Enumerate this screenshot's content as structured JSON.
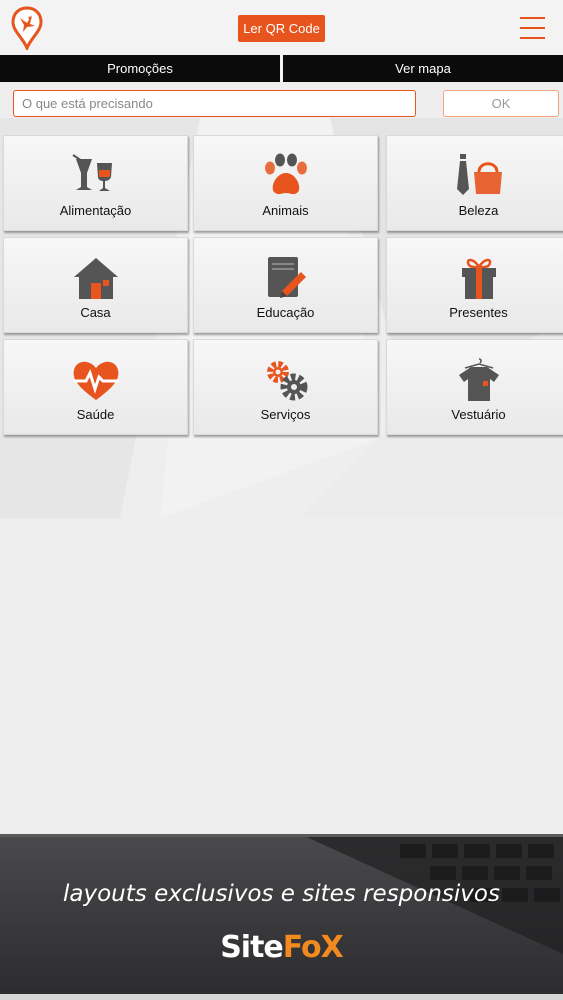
{
  "header": {
    "logo_icon": "location-pin-bird-icon",
    "qr_button_label": "Ler QR Code",
    "menu_icon": "hamburger-menu-icon",
    "accent_color": "#e8541e"
  },
  "tabs": [
    {
      "label": "Promoções"
    },
    {
      "label": "Ver mapa"
    }
  ],
  "search": {
    "placeholder": "O que está precisando",
    "value": "",
    "ok_label": "OK"
  },
  "categories": [
    {
      "label": "Alimentação",
      "icon": "drinks-glasses-icon"
    },
    {
      "label": "Animais",
      "icon": "paw-icon"
    },
    {
      "label": "Beleza",
      "icon": "tie-handbag-icon"
    },
    {
      "label": "Casa",
      "icon": "house-icon"
    },
    {
      "label": "Educação",
      "icon": "notebook-pencil-icon"
    },
    {
      "label": "Presentes",
      "icon": "gift-icon"
    },
    {
      "label": "Saúde",
      "icon": "heart-pulse-icon"
    },
    {
      "label": "Serviços",
      "icon": "gears-icon"
    },
    {
      "label": "Vestuário",
      "icon": "tshirt-hanger-icon"
    }
  ],
  "banner": {
    "tagline": "layouts exclusivos e sites responsivos",
    "brand_part1": "Site",
    "brand_part2": "FoX"
  }
}
